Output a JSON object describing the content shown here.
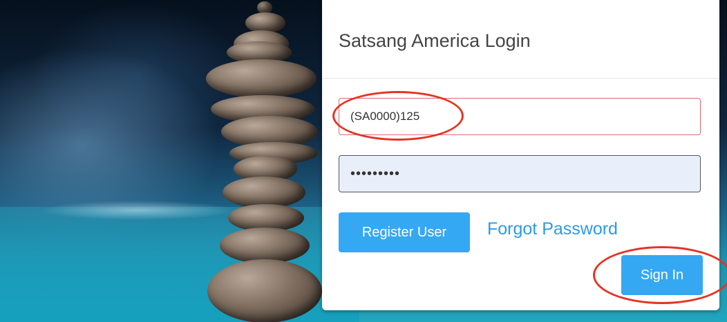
{
  "login": {
    "title": "Satsang America Login",
    "username_value": "(SA0000)125",
    "password_value": "•••••••••",
    "register_label": "Register User",
    "forgot_label": "Forgot Password",
    "signin_label": "Sign In"
  },
  "colors": {
    "primary_button": "#35a8f3",
    "link": "#2a9be8",
    "annotation": "#e53323",
    "error_border": "#d96a6a"
  }
}
